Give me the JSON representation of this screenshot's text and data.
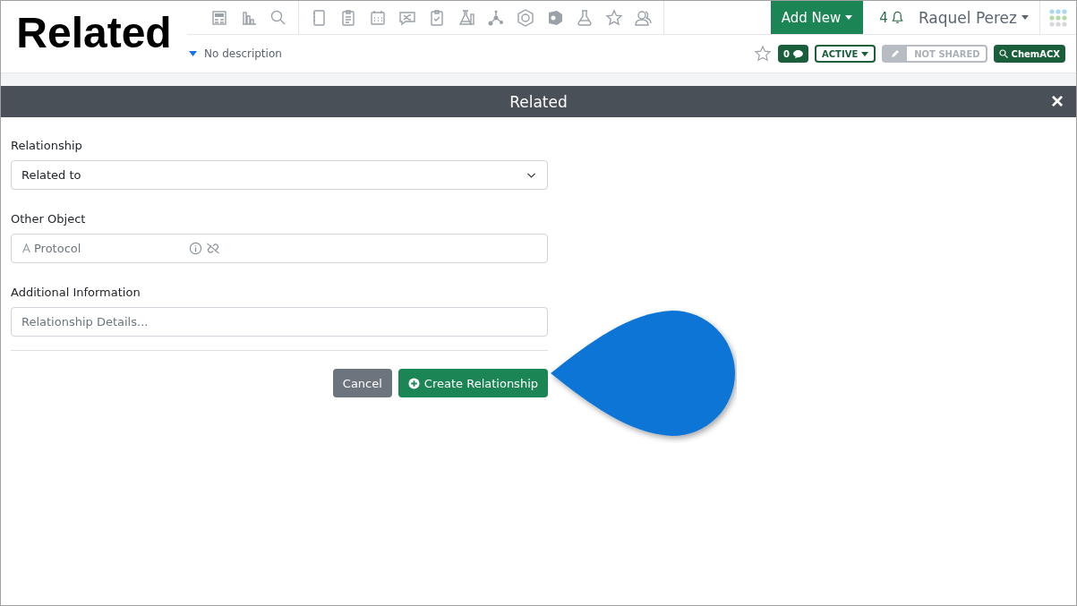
{
  "caption": "Related",
  "nav": {
    "add_new": "Add New",
    "notifications": "4",
    "user": "Raquel Perez"
  },
  "subbar": {
    "description": "No description",
    "comments": "0",
    "status": "ACTIVE",
    "sharing": "NOT SHARED",
    "search": "ChemACX"
  },
  "modal": {
    "title": "Related",
    "close": "×",
    "fields": [
      {
        "kind": "select",
        "label": "Relationship",
        "value": "Related to"
      },
      {
        "kind": "lookup",
        "label": "Other Object",
        "placeholder": "Protocol"
      },
      {
        "kind": "text",
        "label": "Additional Information",
        "placeholder": "Relationship Details..."
      }
    ],
    "buttons": [
      {
        "kind": "secondary",
        "label": "Cancel"
      },
      {
        "kind": "primary",
        "label": "Create Relationship"
      }
    ]
  }
}
